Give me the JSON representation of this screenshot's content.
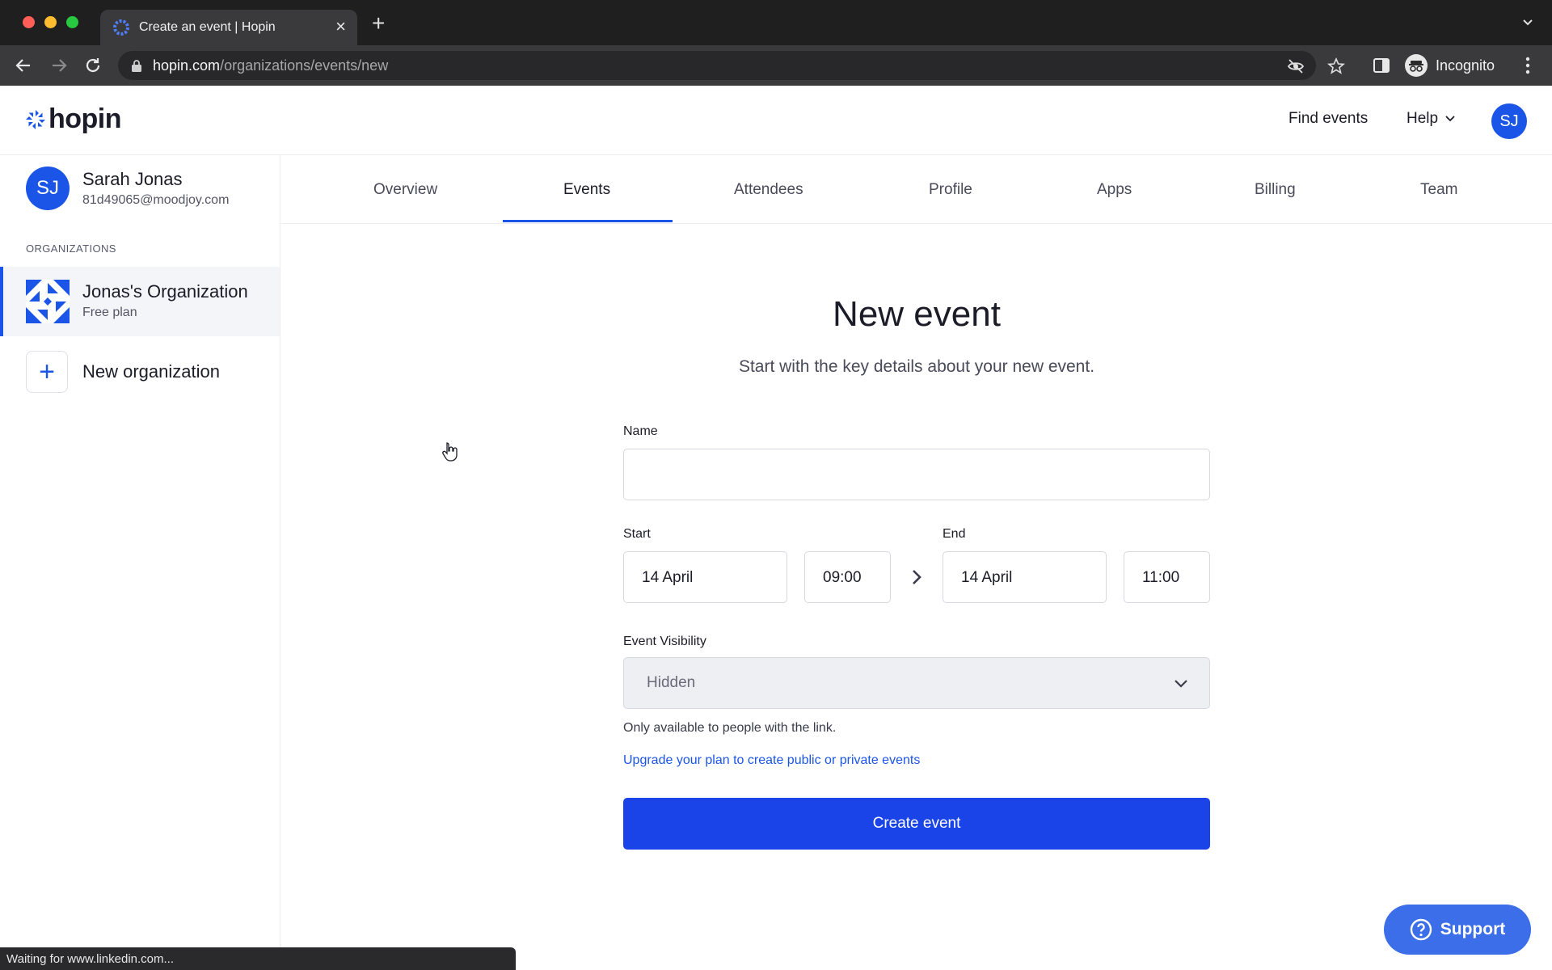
{
  "browser": {
    "tab_title": "Create an event | Hopin",
    "url_host": "hopin.com",
    "url_path": "/organizations/events/new",
    "profile_label": "Incognito",
    "status_text": "Waiting for www.linkedin.com..."
  },
  "header": {
    "logo_text": "hopin",
    "find_events": "Find events",
    "help": "Help",
    "avatar_initials": "SJ"
  },
  "sidebar": {
    "user": {
      "initials": "SJ",
      "name": "Sarah Jonas",
      "email": "81d49065@moodjoy.com"
    },
    "section_label": "ORGANIZATIONS",
    "org": {
      "name": "Jonas's Organization",
      "plan": "Free plan"
    },
    "new_org_label": "New organization"
  },
  "subnav": {
    "tabs": [
      {
        "label": "Overview"
      },
      {
        "label": "Events",
        "active": true
      },
      {
        "label": "Attendees"
      },
      {
        "label": "Profile"
      },
      {
        "label": "Apps"
      },
      {
        "label": "Billing"
      },
      {
        "label": "Team"
      }
    ]
  },
  "form": {
    "title": "New event",
    "subtitle": "Start with the key details about your new event.",
    "name_label": "Name",
    "name_value": "",
    "start_label": "Start",
    "start_date": "14 April",
    "start_time": "09:00",
    "end_label": "End",
    "end_date": "14 April",
    "end_time": "11:00",
    "visibility_label": "Event Visibility",
    "visibility_value": "Hidden",
    "visibility_hint": "Only available to people with the link.",
    "upgrade_link": "Upgrade your plan to create public or private events",
    "submit_label": "Create event"
  },
  "support": {
    "label": "Support"
  },
  "colors": {
    "brand_blue": "#1b55e8",
    "button_blue": "#1b44e8",
    "support_blue": "#3b6ee8"
  }
}
